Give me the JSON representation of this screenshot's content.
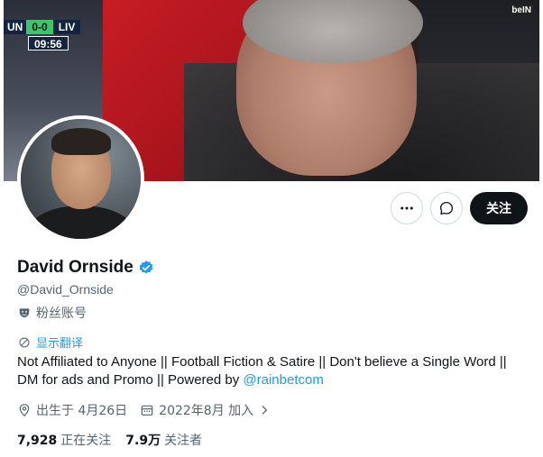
{
  "banner": {
    "score_home": "UN",
    "score_result": "0-0",
    "score_away": "LIV",
    "clock": "09:56",
    "broadcaster": "beIN"
  },
  "actions": {
    "more_icon": "more-icon",
    "message_icon": "message-icon",
    "follow_label": "关注"
  },
  "profile": {
    "name": "David Ornside",
    "verified_icon": "verified-badge-icon",
    "handle": "@David_Ornside",
    "parody_label": "粉丝账号",
    "translate_label": "显示翻译",
    "bio_text": "Not Affiliated to Anyone || Football Fiction & Satire || Don't believe a Single Word || DM for ads and Promo || Powered by ",
    "bio_link": "@rainbetcom",
    "birthday": "出生于 4月26日",
    "joined": "2022年8月 加入"
  },
  "stats": {
    "following_count": "7,928",
    "following_label": "正在关注",
    "followers_count": "7.9万",
    "followers_label": "关注者"
  },
  "colors": {
    "accent": "#1d9bf0",
    "text_primary": "#0f1419",
    "text_secondary": "#536471",
    "follow_bg": "#0f1419"
  }
}
